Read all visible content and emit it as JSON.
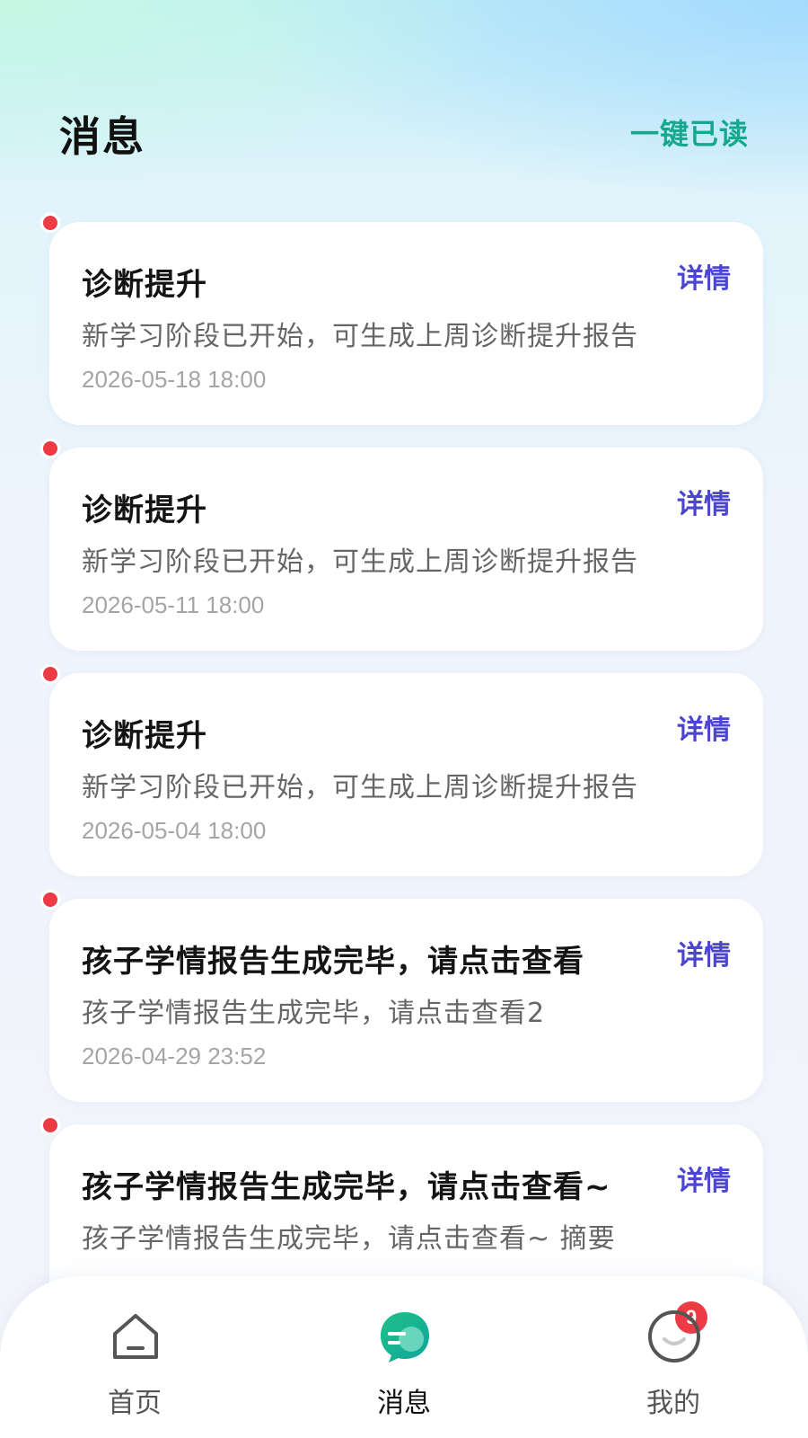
{
  "header": {
    "title": "消息",
    "mark_all_read": "一键已读"
  },
  "messages": [
    {
      "title": "诊断提升",
      "description": "新学习阶段已开始，可生成上周诊断提升报告",
      "time": "2026-05-18 18:00",
      "detail_label": "详情",
      "unread": true
    },
    {
      "title": "诊断提升",
      "description": "新学习阶段已开始，可生成上周诊断提升报告",
      "time": "2026-05-11 18:00",
      "detail_label": "详情",
      "unread": true
    },
    {
      "title": "诊断提升",
      "description": "新学习阶段已开始，可生成上周诊断提升报告",
      "time": "2026-05-04 18:00",
      "detail_label": "详情",
      "unread": true
    },
    {
      "title": "孩子学情报告生成完毕，请点击查看",
      "description": "孩子学情报告生成完毕，请点击查看2",
      "time": "2026-04-29 23:52",
      "detail_label": "详情",
      "unread": true
    },
    {
      "title": "孩子学情报告生成完毕，请点击查看~",
      "description": "孩子学情报告生成完毕，请点击查看~ 摘要",
      "time": "",
      "detail_label": "详情",
      "unread": true
    }
  ],
  "tabbar": {
    "tabs": [
      {
        "label": "首页",
        "icon": "home-icon",
        "active": false
      },
      {
        "label": "消息",
        "icon": "message-icon",
        "active": true,
        "badge": "9"
      },
      {
        "label": "我的",
        "icon": "profile-icon",
        "active": false
      }
    ]
  },
  "colors": {
    "accent_green": "#16a88f",
    "detail_purple": "#4b45cf",
    "unread_dot": "#ec3b44"
  }
}
